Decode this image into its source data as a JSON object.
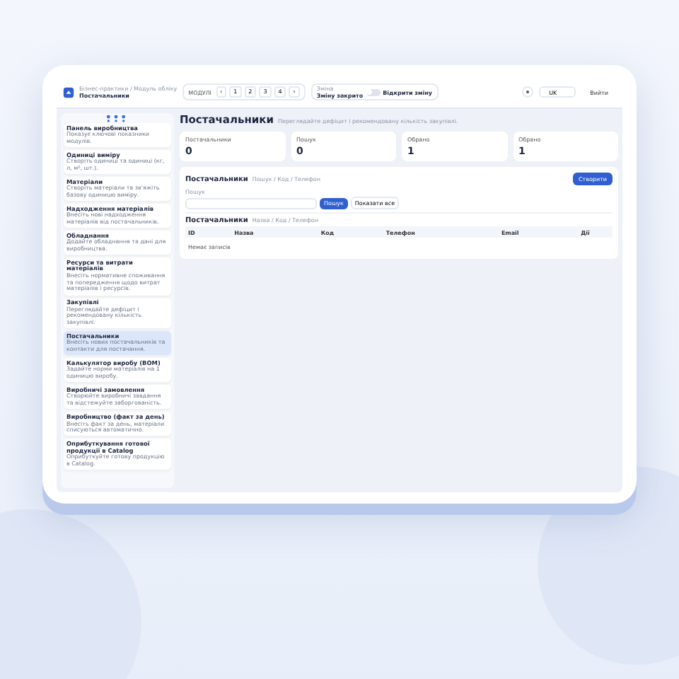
{
  "header": {
    "breadcrumb": "Бізнес-практики / Модуль обліку",
    "title": "Постачальники",
    "modules_label": "МОДУЛІ",
    "module_buttons": [
      "‹",
      "1",
      "2",
      "3",
      "4",
      "›"
    ],
    "shift_label": "Зміна",
    "shift_status": "Зміну закрито",
    "shift_toggle": {
      "on": false,
      "label": "Відкрити зміну"
    },
    "language": "UK",
    "logout": "Вийти"
  },
  "sidebar": {
    "items": [
      {
        "title": "Панель виробництва",
        "description": "Показує ключові показники модулів.",
        "selected": false
      },
      {
        "title": "Одиниці виміру",
        "description": "Створіть одиниці та одиниці (кг, л, м², шт.).",
        "selected": false
      },
      {
        "title": "Матеріали",
        "description": "Створіть матеріали та зв'яжіть базову одиницю виміру.",
        "selected": false
      },
      {
        "title": "Надходження матеріалів",
        "description": "Внесіть нові надходження матеріалів від постачальників.",
        "selected": false
      },
      {
        "title": "Обладнання",
        "description": "Додайте обладнання та дані для виробництва.",
        "selected": false
      },
      {
        "title": "Ресурси та витрати матеріалів",
        "description": "Внесіть нормативне споживання та попередження щодо витрат матеріалів і ресурсів.",
        "selected": false
      },
      {
        "title": "Закупівлі",
        "description": "Переглядайте дефіцит і рекомендовану кількість закупівлі.",
        "selected": false
      },
      {
        "title": "Постачальники",
        "description": "Внесіть нових постачальників та контакти для постачання.",
        "selected": true
      },
      {
        "title": "Калькулятор виробу (BOM)",
        "description": "Задайте норми матеріалів на 1 одиницю виробу.",
        "selected": false
      },
      {
        "title": "Виробничі замовлення",
        "description": "Створюйте виробничі завдання та відстежуйте заборгованість.",
        "selected": false
      },
      {
        "title": "Виробництво (факт за день)",
        "description": "Внесіть факт за день, матеріали списуються автоматично.",
        "selected": false
      },
      {
        "title": "Оприбуткування готової продукції в Catalog",
        "description": "Оприбуткуйте готову продукцію в Catalog.",
        "selected": false
      }
    ]
  },
  "page": {
    "title": "Постачальники",
    "subtitle": "Переглядайте дефіцит і рекомендовану кількість закупівлі."
  },
  "stats": [
    {
      "label": "Постачальники",
      "value": "0"
    },
    {
      "label": "Пошук",
      "value": "0"
    },
    {
      "label": "Обрано",
      "value": "1"
    },
    {
      "label": "Обрано",
      "value": "1"
    }
  ],
  "card": {
    "title": "Постачальники",
    "hint": "Пошук / Код / Телефон",
    "create_button": "Створити",
    "search_label": "Пошук",
    "search_button": "Пошук",
    "show_all_button": "Показати все",
    "table_title": "Постачальники",
    "table_hint": "Назва / Код / Телефон",
    "columns": [
      "ID",
      "Назва",
      "Код",
      "Телефон",
      "Email",
      "Дії"
    ],
    "empty": "Немає записів"
  }
}
